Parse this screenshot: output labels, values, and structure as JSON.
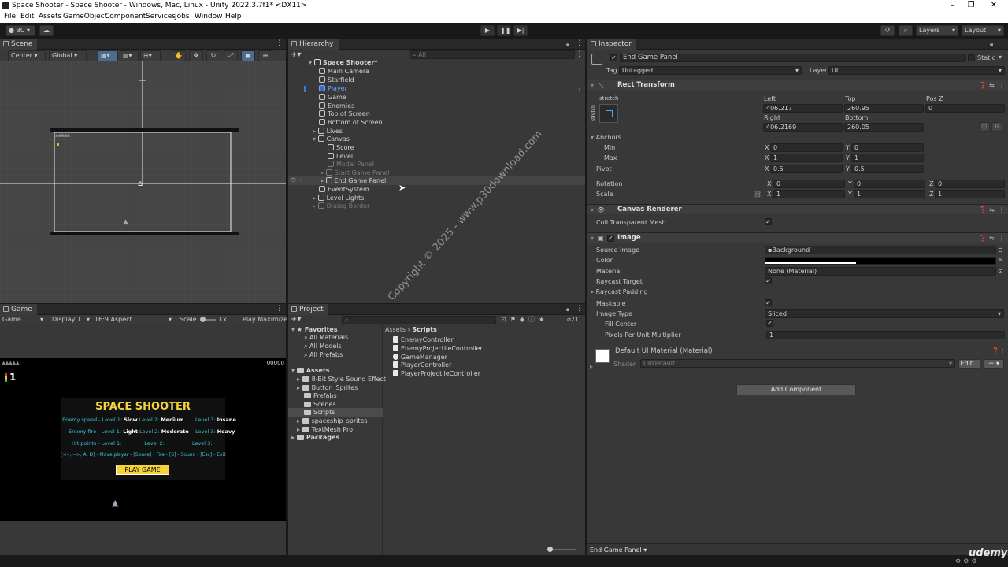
{
  "window": {
    "title": "Space Shooter - Space Shooter - Windows, Mac, Linux - Unity 2022.3.7f1* <DX11>"
  },
  "menu": [
    "File",
    "Edit",
    "Assets",
    "GameObject",
    "Component",
    "Services",
    "Jobs",
    "Window",
    "Help"
  ],
  "toolbar": {
    "account": "BC",
    "layers": "Layers",
    "layout": "Layout"
  },
  "scene": {
    "tab": "Scene",
    "pivot": "Center",
    "space": "Global"
  },
  "game": {
    "tab": "Game",
    "mode": "Game",
    "display": "Display 1",
    "aspect": "16:9 Aspect",
    "scale_label": "Scale",
    "scale_value": "1x",
    "play_mode": "Play Maximize",
    "score": "00000",
    "lives": "1",
    "title": "SPACE SHOOTER",
    "row1": {
      "a": "Enemy speed - Level 1:",
      "b": "Slow",
      "c": "Level 2:",
      "d": "Medium",
      "e": "Level 3:",
      "f": "Insane"
    },
    "row2": {
      "a": "Enemy fire - Level 1:",
      "b": "Light",
      "c": "Level 2:",
      "d": "Moderate",
      "e": "Level 3:",
      "f": "Heavy"
    },
    "row3": {
      "a": "Hit points - Level 1:",
      "c": "Level 2:",
      "e": "Level 3:"
    },
    "controls": "[<--, -->, A, D] - Move player - [Space] - Fire - [S] - Sound - [Esc] - Exit",
    "play_button": "PLAY GAME"
  },
  "hierarchy": {
    "tab": "Hierarchy",
    "search_placeholder": "All",
    "root": "Space Shooter*",
    "items": [
      "Main Camera",
      "Starfield",
      "Player",
      "Game",
      "Enemies",
      "Top of Screen",
      "Bottom of Screen",
      "Lives",
      "Canvas",
      "Score",
      "Level",
      "Modal Panel",
      "Start Game Panel",
      "End Game Panel",
      "EventSystem",
      "Level Lights",
      "Dialog Border"
    ]
  },
  "project": {
    "tab": "Project",
    "count": "21",
    "favorites": {
      "label": "Favorites",
      "items": [
        "All Materials",
        "All Models",
        "All Prefabs"
      ]
    },
    "assets": {
      "label": "Assets",
      "items": [
        "8-Bit Style Sound Effect",
        "Button_Sprites",
        "Prefabs",
        "Scenes",
        "Scripts",
        "spaceship_sprites",
        "TextMesh Pro"
      ]
    },
    "packages": "Packages",
    "breadcrumb": [
      "Assets",
      "Scripts"
    ],
    "files": [
      "EnemyController",
      "EnemyProjectileController",
      "GameManager",
      "PlayerController",
      "PlayerProjectileController"
    ]
  },
  "inspector": {
    "tab": "Inspector",
    "object_name": "End Game Panel",
    "static_label": "Static",
    "tag_label": "Tag",
    "tag_value": "Untagged",
    "layer_label": "Layer",
    "layer_value": "UI",
    "rect": {
      "title": "Rect Transform",
      "anchor_preset": "stretch",
      "left_label": "Left",
      "left": "406.217",
      "top_label": "Top",
      "top": "260.95",
      "posz_label": "Pos Z",
      "posz": "0",
      "right_label": "Right",
      "right": "406.2169",
      "bottom_label": "Bottom",
      "bottom": "260.05",
      "anchors": "Anchors",
      "min": "Min",
      "min_x": "0",
      "min_y": "0",
      "max": "Max",
      "max_x": "1",
      "max_y": "1",
      "pivot": "Pivot",
      "pivot_x": "0.5",
      "pivot_y": "0.5",
      "rotation": "Rotation",
      "rot_x": "0",
      "rot_y": "0",
      "rot_z": "0",
      "scale": "Scale",
      "scale_x": "1",
      "scale_y": "1",
      "scale_z": "1"
    },
    "canvas_renderer": {
      "title": "Canvas Renderer",
      "cull": "Cull Transparent Mesh"
    },
    "image": {
      "title": "Image",
      "source_label": "Source Image",
      "source": "Background",
      "color_label": "Color",
      "material_label": "Material",
      "material": "None (Material)",
      "raycast_target": "Raycast Target",
      "raycast_padding": "Raycast Padding",
      "maskable": "Maskable",
      "image_type_label": "Image Type",
      "image_type": "Sliced",
      "fill_center": "Fill Center",
      "ppu_label": "Pixels Per Unit Multiplier",
      "ppu": "1"
    },
    "material": {
      "title": "Default UI Material (Material)",
      "shader_label": "Shader",
      "shader": "UI/Default",
      "edit": "Edit..."
    },
    "add_component": "Add Component",
    "footer": "End Game Panel"
  },
  "watermark": "Copyright © 2025 - www.p30download.com",
  "udemy": "udemy"
}
